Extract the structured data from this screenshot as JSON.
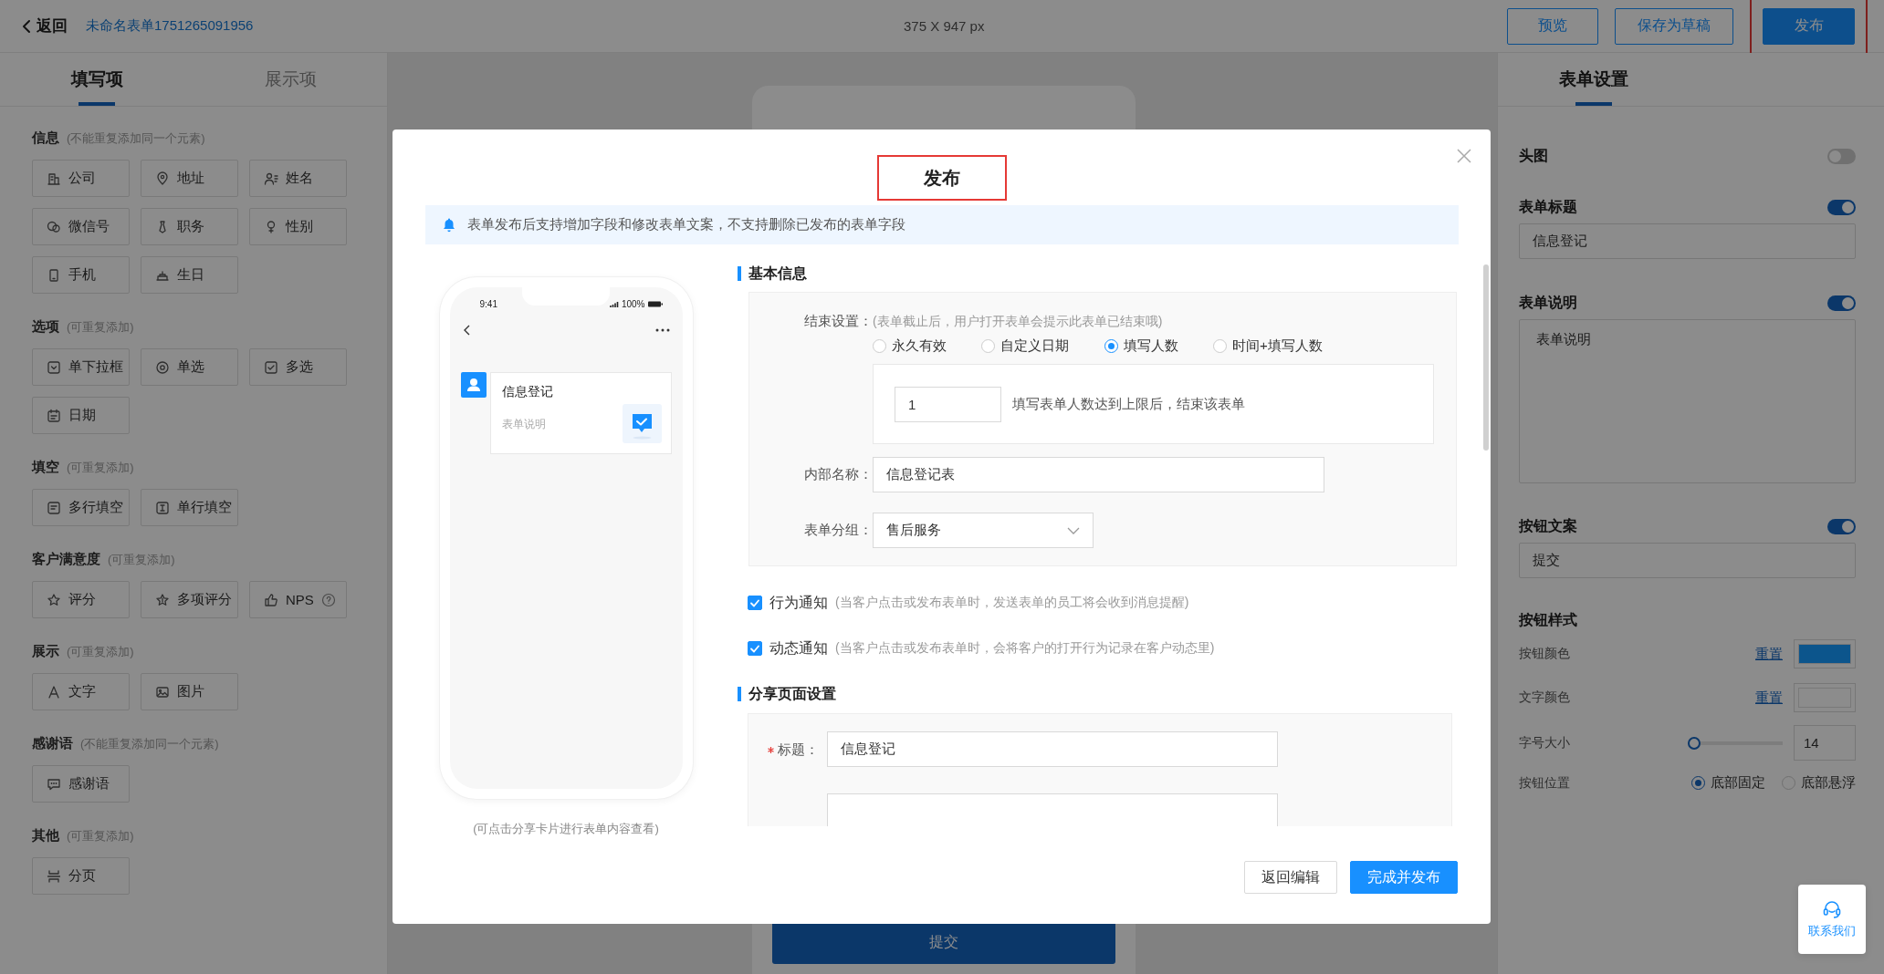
{
  "top_bar": {
    "back_label": "返回",
    "form_name": "未命名表单1751265091956",
    "canvas_size": "375 X 947 px",
    "buttons": [
      {
        "label": "预览",
        "kind": "outline",
        "highlighted": false
      },
      {
        "label": "保存为草稿",
        "kind": "outline",
        "highlighted": false
      },
      {
        "label": "发布",
        "kind": "primary",
        "highlighted": true
      }
    ]
  },
  "left_panel": {
    "tabs": [
      {
        "label": "填写项",
        "selected": true
      },
      {
        "label": "展示项",
        "selected": false
      }
    ],
    "sections": [
      {
        "title": "信息",
        "note": "(不能重复添加同一个元素)",
        "items": [
          {
            "label": "公司",
            "kind": "plain"
          },
          {
            "label": "地址",
            "kind": "plain"
          },
          {
            "label": "姓名",
            "kind": "plain"
          },
          {
            "label": "微信号",
            "kind": "plain"
          },
          {
            "label": "职务",
            "kind": "plain"
          },
          {
            "label": "性别",
            "kind": "plain"
          },
          {
            "label": "手机",
            "kind": "plain"
          },
          {
            "label": "生日",
            "kind": "plain"
          }
        ]
      },
      {
        "title": "选项",
        "note": "(可重复添加)",
        "items": [
          {
            "label": "单下拉框",
            "kind": "plain"
          },
          {
            "label": "单选",
            "kind": "plain"
          },
          {
            "label": "多选",
            "kind": "plain"
          },
          {
            "label": "日期",
            "kind": "plain"
          }
        ]
      },
      {
        "title": "填空",
        "note": "(可重复添加)",
        "items": [
          {
            "label": "多行填空",
            "kind": "plain"
          },
          {
            "label": "单行填空",
            "kind": "plain"
          }
        ]
      },
      {
        "title": "客户满意度",
        "note": "(可重复添加)",
        "items": [
          {
            "label": "评分",
            "kind": "plain"
          },
          {
            "label": "多项评分",
            "kind": "plain"
          },
          {
            "label": "NPS",
            "kind": "help"
          }
        ]
      },
      {
        "title": "展示",
        "note": "(可重复添加)",
        "items": [
          {
            "label": "文字",
            "kind": "plain"
          },
          {
            "label": "图片",
            "kind": "plain"
          }
        ]
      },
      {
        "title": "感谢语",
        "note": "(不能重复添加同一个元素)",
        "items": [
          {
            "label": "感谢语",
            "kind": "plain"
          }
        ]
      },
      {
        "title": "其他",
        "note": "(可重复添加)",
        "items": [
          {
            "label": "分页",
            "kind": "plain"
          }
        ]
      }
    ]
  },
  "canvas": {
    "submit_label": "提交"
  },
  "right_panel": {
    "tabs": [
      {
        "label": "表单设置",
        "selected": true
      }
    ],
    "settings": [
      {
        "kind": "toggle",
        "label": "头图",
        "on": false
      },
      {
        "kind": "toggle_input",
        "label": "表单标题",
        "on": true,
        "value": "信息登记"
      },
      {
        "kind": "toggle_textarea",
        "label": "表单说明",
        "on": true,
        "value": "表单说明"
      },
      {
        "kind": "toggle_input",
        "label": "按钮文案",
        "on": true,
        "value": "提交"
      },
      {
        "kind": "heading",
        "label": "按钮样式"
      },
      {
        "kind": "color",
        "label": "按钮颜色",
        "reset": "重置",
        "color": "#0c568c"
      },
      {
        "kind": "color",
        "label": "文字颜色",
        "reset": "重置",
        "color": "#8c8c8c"
      },
      {
        "kind": "slider",
        "label": "字号大小",
        "level": 0,
        "value": "14"
      },
      {
        "kind": "radio",
        "label": "按钮位置",
        "options": [
          {
            "label": "底部固定",
            "selected": true
          },
          {
            "label": "底部悬浮",
            "selected": false
          }
        ]
      }
    ]
  },
  "modal": {
    "title": "发布",
    "title_highlighted": true,
    "notice": "表单发布后支持增加字段和修改表单文案，不支持删除已发布的表单字段",
    "preview": {
      "time": "9:41",
      "battery": "100%",
      "card_title": "信息登记",
      "card_desc": "表单说明",
      "caption": "(可点击分享卡片进行表单内容查看)"
    },
    "basic": {
      "title": "基本信息",
      "end_label": "结束设置：",
      "end_hint": "(表单截止后，用户打开表单会提示此表单已结束哦)",
      "end_options": [
        {
          "label": "永久有效",
          "selected": false
        },
        {
          "label": "自定义日期",
          "selected": false
        },
        {
          "label": "填写人数",
          "selected": true
        },
        {
          "label": "时间+填写人数",
          "selected": false
        }
      ],
      "limit_value": "1",
      "limit_hint": "填写表单人数达到上限后，结束该表单",
      "name_label": "内部名称：",
      "name_value": "信息登记表",
      "group_label": "表单分组：",
      "group_value": "售后服务"
    },
    "notifications": [
      {
        "label": "行为通知",
        "checked": true,
        "hint": "(当客户点击或发布表单时，发送表单的员工将会收到消息提醒)"
      },
      {
        "label": "动态通知",
        "checked": true,
        "hint": "(当客户点击或发布表单时，会将客户的打开行为记录在客户动态里)"
      }
    ],
    "share": {
      "title": "分享页面设置",
      "fields": [
        {
          "label": "标题：",
          "required": true,
          "value": "信息登记"
        }
      ]
    },
    "buttons": [
      {
        "label": "返回编辑",
        "kind": "default"
      },
      {
        "label": "完成并发布",
        "kind": "primary"
      }
    ]
  },
  "contact": {
    "label": "联系我们"
  }
}
